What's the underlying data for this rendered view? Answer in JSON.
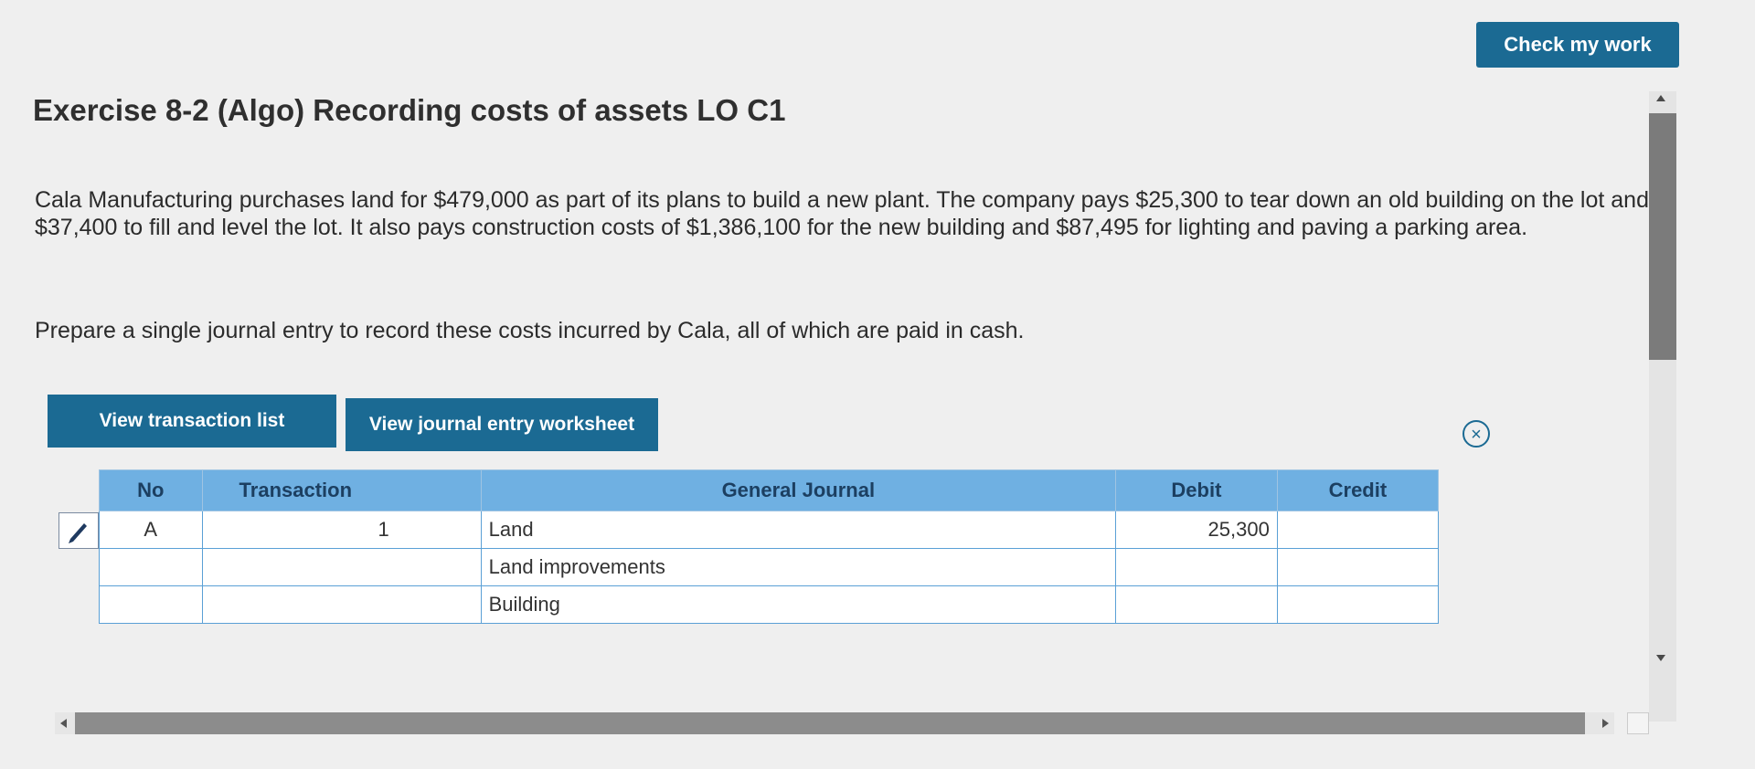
{
  "header": {
    "check_label": "Check my work"
  },
  "exercise": {
    "title": "Exercise 8-2 (Algo) Recording costs of assets LO C1",
    "problem": "Cala Manufacturing purchases land for $479,000 as part of its plans to build a new plant. The company pays $25,300 to tear down an old building on the lot and $37,400 to fill and level the lot. It also pays construction costs of $1,386,100 for the new building and $87,495 for lighting and paving a parking area.",
    "instruction": "Prepare a single journal entry to record these costs incurred by Cala, all of which are paid in cash."
  },
  "tabs": {
    "transaction_list": "View transaction list",
    "journal_worksheet": "View journal entry worksheet"
  },
  "icons": {
    "close": "close-icon",
    "edit": "pencil-icon"
  },
  "table": {
    "headers": {
      "no": "No",
      "transaction": "Transaction",
      "general_journal": "General Journal",
      "debit": "Debit",
      "credit": "Credit"
    },
    "rows": [
      {
        "no": "A",
        "transaction": "1",
        "account": "Land",
        "debit": "25,300",
        "credit": ""
      },
      {
        "no": "",
        "transaction": "",
        "account": "Land improvements",
        "debit": "",
        "credit": ""
      },
      {
        "no": "",
        "transaction": "",
        "account": "Building",
        "debit": "",
        "credit": ""
      }
    ]
  },
  "colors": {
    "accent": "#1b6a93",
    "table_header": "#6fb0e2",
    "background": "#efefef"
  }
}
